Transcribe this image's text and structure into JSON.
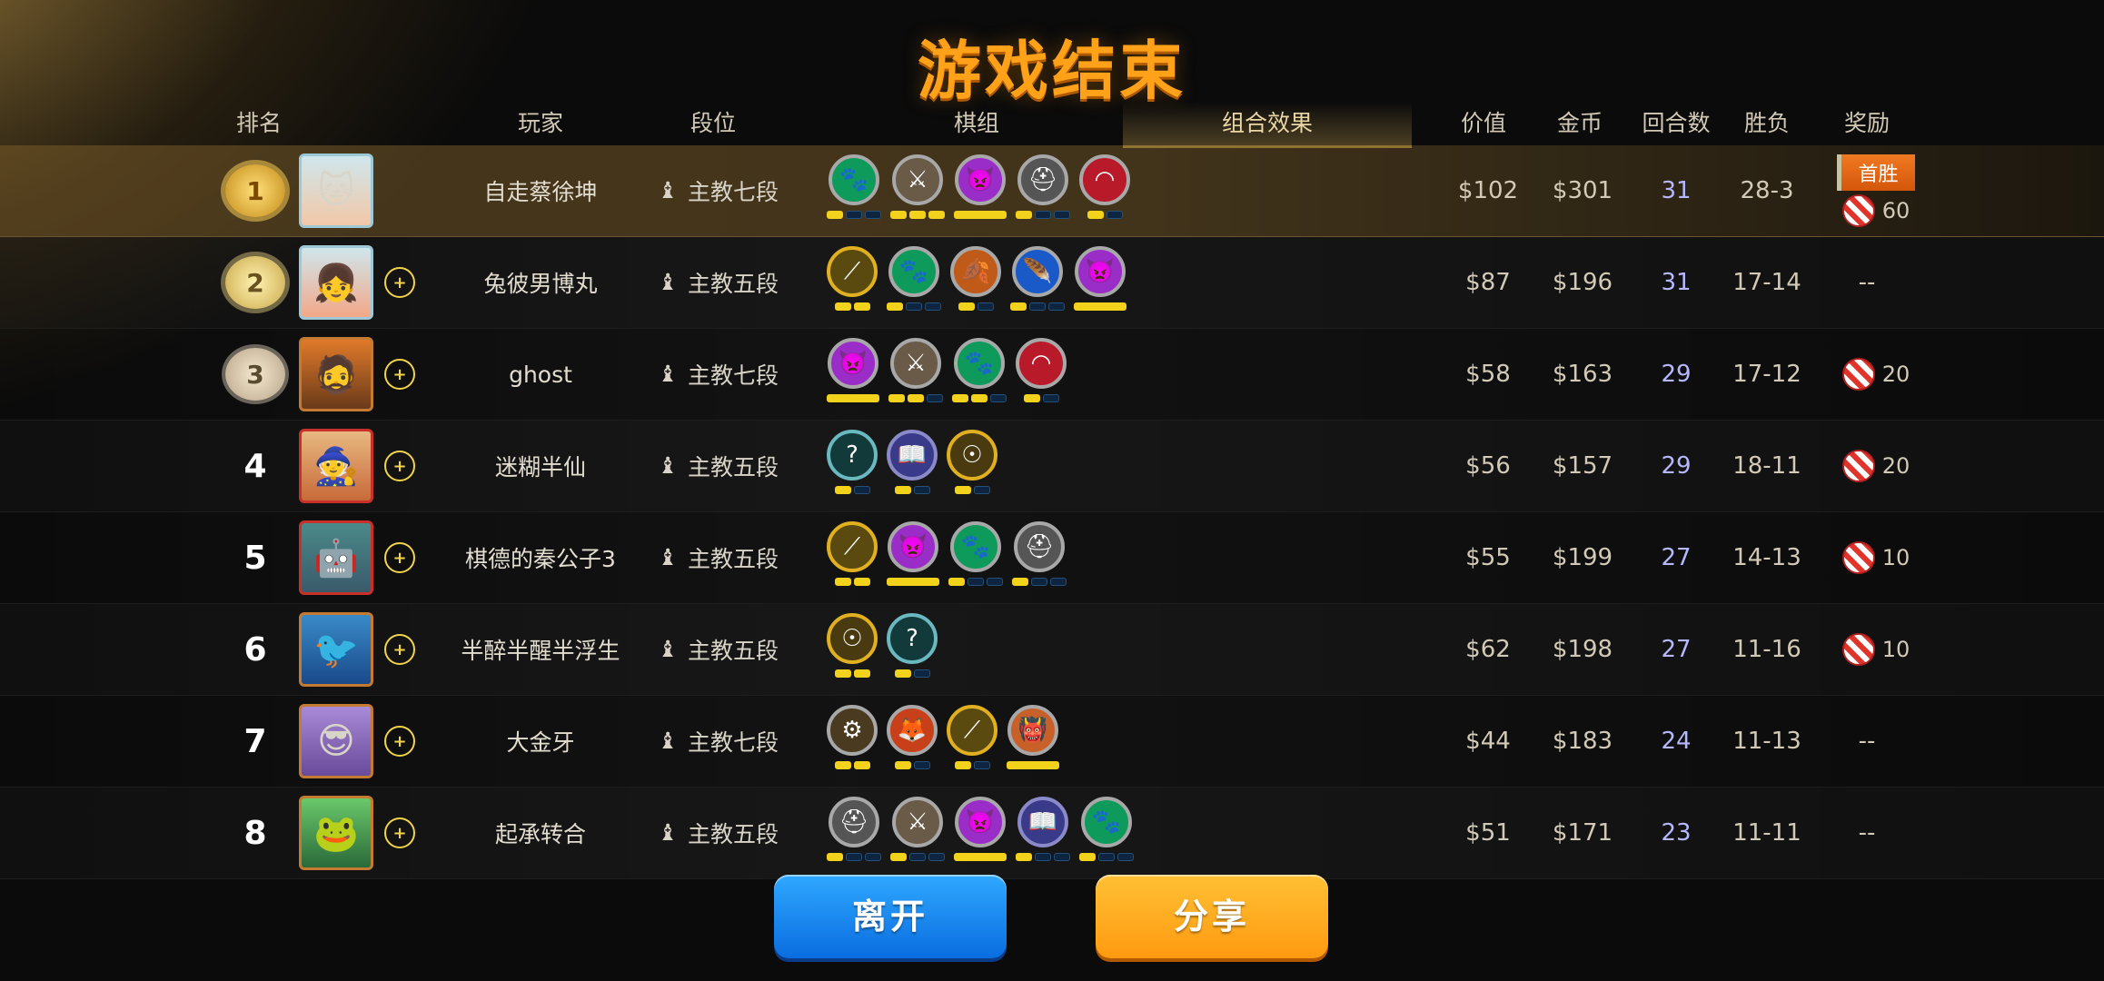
{
  "title": "游戏结束",
  "headers": {
    "rank": "排名",
    "player": "玩家",
    "tier": "段位",
    "lineup": "棋组",
    "synergy": "组合效果",
    "value": "价值",
    "gold": "金币",
    "rounds": "回合数",
    "record": "胜负",
    "reward": "奖励"
  },
  "rows": [
    {
      "rank": "",
      "player": "自走蔡徐坤",
      "tier": "主教七段",
      "value": "$102",
      "gold": "$301",
      "rounds": "31",
      "record": "28-3",
      "reward_flag": "首胜",
      "reward": "60"
    },
    {
      "rank": "",
      "player": "兔彼男博丸",
      "tier": "主教五段",
      "value": "$87",
      "gold": "$196",
      "rounds": "31",
      "record": "17-14",
      "reward": "--"
    },
    {
      "rank": "",
      "player": "ghost",
      "tier": "主教七段",
      "value": "$58",
      "gold": "$163",
      "rounds": "29",
      "record": "17-12",
      "reward": "20"
    },
    {
      "rank": "4",
      "player": "迷糊半仙",
      "tier": "主教五段",
      "value": "$56",
      "gold": "$157",
      "rounds": "29",
      "record": "18-11",
      "reward": "20"
    },
    {
      "rank": "5",
      "player": "棋德的秦公子3",
      "tier": "主教五段",
      "value": "$55",
      "gold": "$199",
      "rounds": "27",
      "record": "14-13",
      "reward": "10"
    },
    {
      "rank": "6",
      "player": "半醉半醒半浮生",
      "tier": "主教五段",
      "value": "$62",
      "gold": "$198",
      "rounds": "27",
      "record": "11-16",
      "reward": "10"
    },
    {
      "rank": "7",
      "player": "大金牙",
      "tier": "主教七段",
      "value": "$44",
      "gold": "$183",
      "rounds": "24",
      "record": "11-13",
      "reward": "--"
    },
    {
      "rank": "8",
      "player": "起承转合",
      "tier": "主教五段",
      "value": "$51",
      "gold": "$171",
      "rounds": "23",
      "record": "11-11",
      "reward": "--"
    }
  ],
  "buttons": {
    "leave": "离开",
    "share": "分享"
  },
  "colors": {
    "title": "#ffa21a",
    "leave_button": "#1a8cf5",
    "share_button": "#ffa820",
    "pip_on": "#f2d21a",
    "rounds_text": "#b7b7ff"
  }
}
